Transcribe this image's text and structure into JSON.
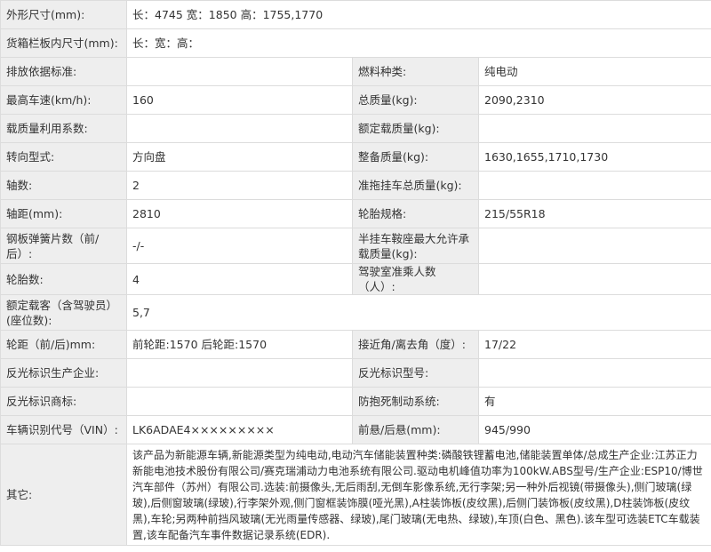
{
  "rows": [
    {
      "label": "外形尺寸(mm):",
      "value": "长：4745 宽：1850 高：1755,1770"
    },
    {
      "label": "货箱栏板内尺寸(mm):",
      "value": "长：宽：高："
    },
    {
      "label": "排放依据标准:",
      "value": "",
      "label2": "燃料种类:",
      "value2": "纯电动"
    },
    {
      "label": "最高车速(km/h):",
      "value": "160",
      "label2": "总质量(kg):",
      "value2": "2090,2310"
    },
    {
      "label": "载质量利用系数:",
      "value": "",
      "label2": "额定载质量(kg):",
      "value2": ""
    },
    {
      "label": "转向型式:",
      "value": "方向盘",
      "label2": "整备质量(kg):",
      "value2": "1630,1655,1710,1730"
    },
    {
      "label": "轴数:",
      "value": "2",
      "label2": "准拖挂车总质量(kg):",
      "value2": ""
    },
    {
      "label": "轴距(mm):",
      "value": "2810",
      "label2": "轮胎规格:",
      "value2": "215/55R18"
    },
    {
      "label": "钢板弹簧片数（前/后）:",
      "value": "-/-",
      "label2": "半挂车鞍座最大允许承载质量(kg):",
      "value2": ""
    },
    {
      "label": "轮胎数:",
      "value": "4",
      "label2": "驾驶室准乘人数（人）:",
      "value2": ""
    },
    {
      "label": "额定载客（含驾驶员）(座位数):",
      "value": "5,7"
    },
    {
      "label": "轮距（前/后)mm:",
      "value": "前轮距:1570 后轮距:1570",
      "label2": "接近角/离去角（度）:",
      "value2": "17/22"
    },
    {
      "label": "反光标识生产企业:",
      "value": "",
      "label2": "反光标识型号:",
      "value2": ""
    },
    {
      "label": "反光标识商标:",
      "value": "",
      "label2": "防抱死制动系统:",
      "value2": "有"
    },
    {
      "label": "车辆识别代号（VIN）:",
      "value": "LK6ADAE4×××××××××",
      "label2": "前悬/后悬(mm):",
      "value2": "945/990"
    },
    {
      "label": "其它:",
      "value": "该产品为新能源车辆,新能源类型为纯电动,电动汽车储能装置种类:磷酸铁锂蓄电池,储能装置单体/总成生产企业:江苏正力新能电池技术股份有限公司/赛克瑞浦动力电池系统有限公司.驱动电机峰值功率为100kW.ABS型号/生产企业:ESP10/博世汽车部件（苏州）有限公司.选装:前摄像头,无后雨刮,无倒车影像系统,无行李架;另一种外后视镜(带摄像头),侧门玻璃(绿玻),后侧窗玻璃(绿玻),行李架外观,侧门窗框装饰膜(哑光黑),A柱装饰板(皮纹黑),后侧门装饰板(皮纹黑),D柱装饰板(皮纹黑),车轮;另两种前挡风玻璃(无光雨量传感器、绿玻),尾门玻璃(无电热、绿玻),车顶(白色、黑色).该车型可选装ETC车载装置,该车配备汽车事件数据记录系统(EDR)."
    }
  ]
}
